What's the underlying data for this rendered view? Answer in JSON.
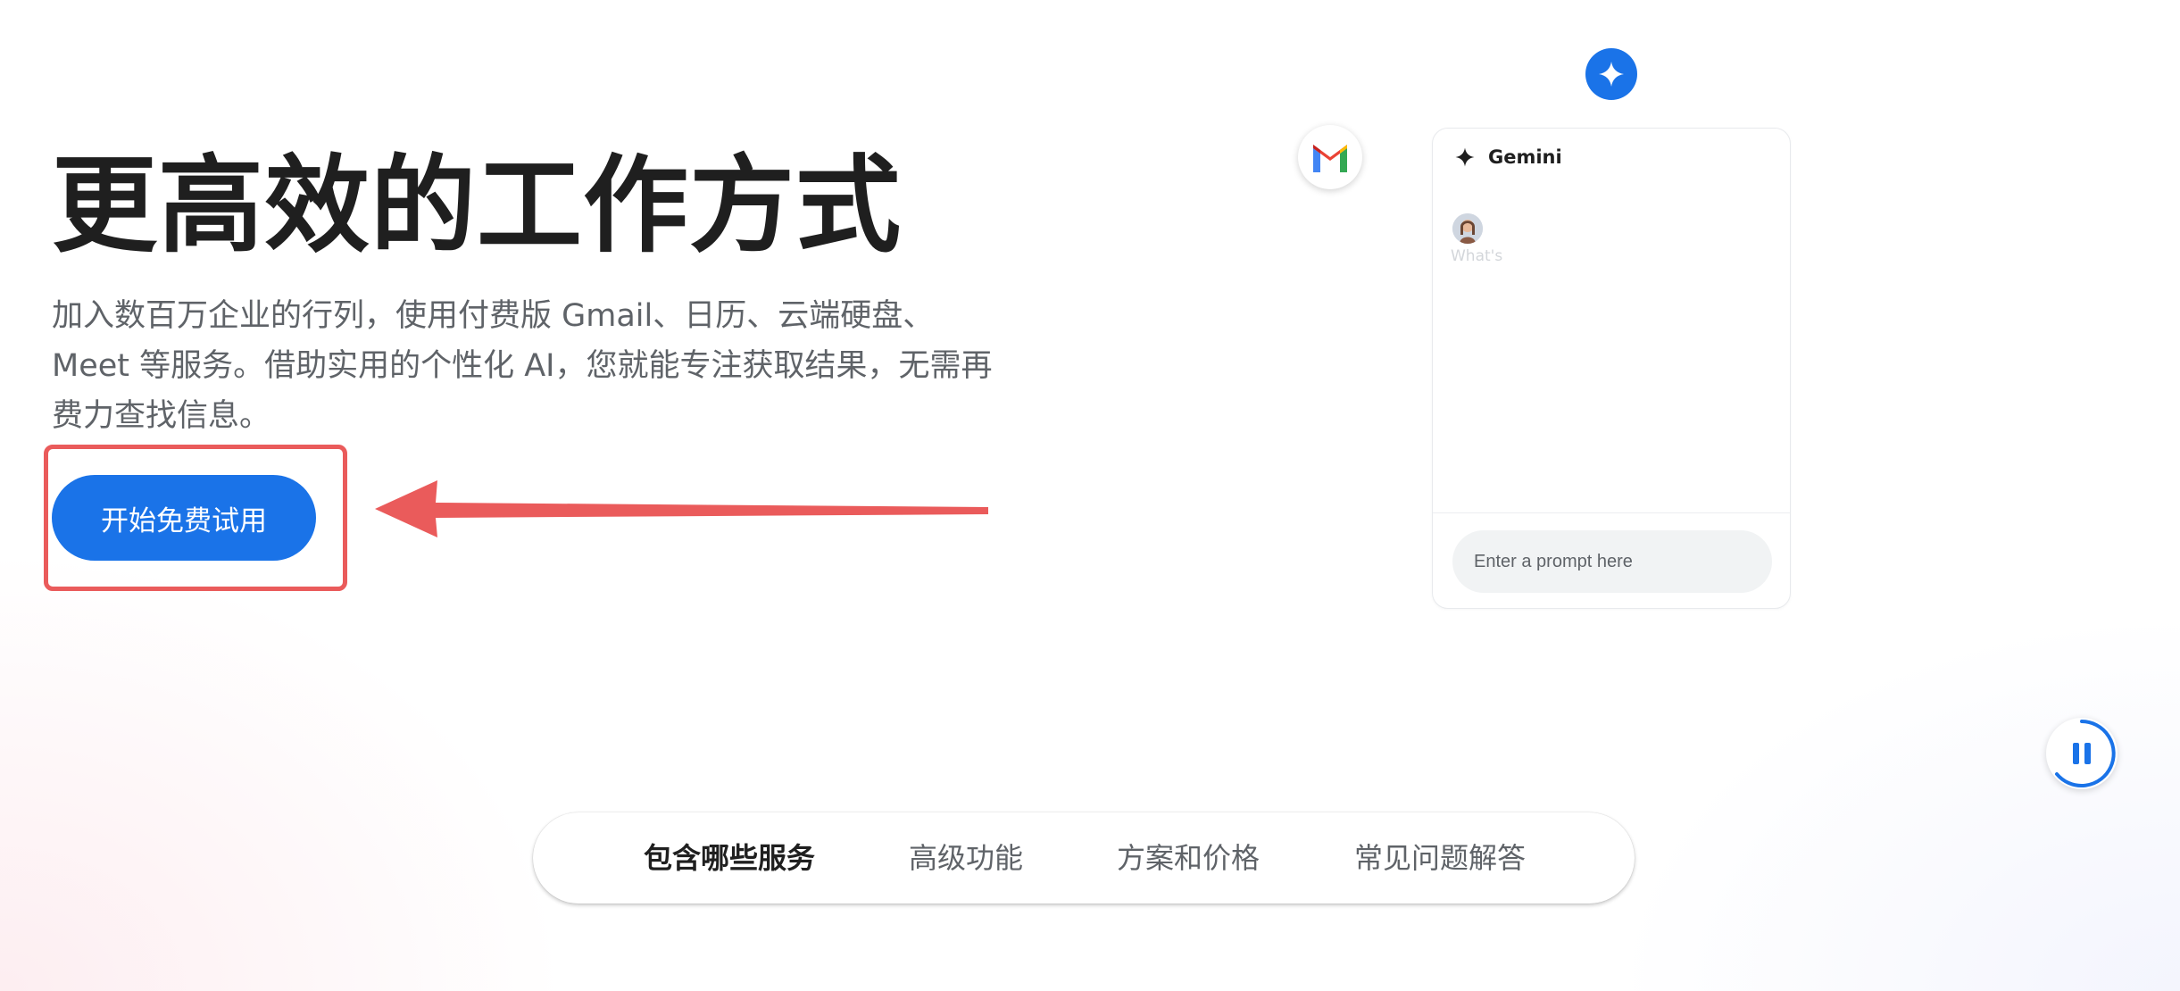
{
  "hero": {
    "title": "更高效的工作方式",
    "description": "加入数百万企业的行列，使用付费版 Gmail、日历、云端硬盘、Meet 等服务。借助实用的个性化 AI，您就能专注获取结果，无需再费力查找信息。",
    "cta_label": "开始免费试用"
  },
  "gemini_panel": {
    "title": "Gemini",
    "chat_snippet": "What's",
    "prompt_placeholder": "Enter a prompt here"
  },
  "nav": {
    "items": [
      {
        "label": "包含哪些服务",
        "active": true
      },
      {
        "label": "高级功能",
        "active": false
      },
      {
        "label": "方案和价格",
        "active": false
      },
      {
        "label": "常见问题解答",
        "active": false
      }
    ]
  },
  "icons": {
    "gmail": "gmail-logo-icon",
    "spark": "gemini-spark-icon",
    "pause": "pause-icon",
    "arrow": "annotation-arrow"
  },
  "colors": {
    "primary_blue": "#1a73e8",
    "annotation_red": "#ea5b5b",
    "title_text": "#1f1f1f",
    "body_text": "#5f6368"
  }
}
